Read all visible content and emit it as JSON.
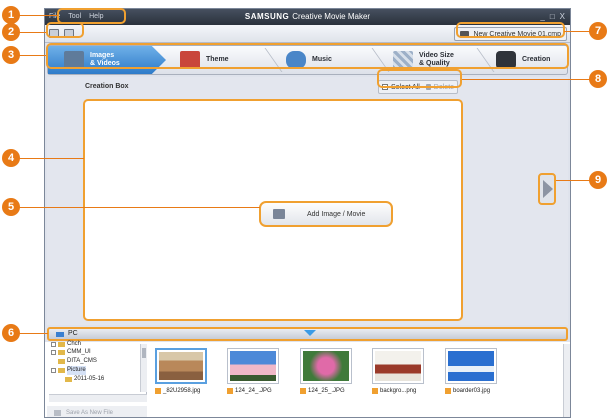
{
  "menu": [
    "File",
    "Tool",
    "Help"
  ],
  "app": {
    "brand": "SAMSUNG",
    "title": "Creative Movie Maker"
  },
  "window_controls": [
    "_",
    "□",
    "X"
  ],
  "project_file": "New Creative Movie 01.cmp",
  "steps": [
    {
      "line1": "Images",
      "line2": "& Videos",
      "active": true
    },
    {
      "line1": "Theme",
      "line2": ""
    },
    {
      "line1": "Music",
      "line2": ""
    },
    {
      "line1": "Video Size",
      "line2": "& Quality"
    },
    {
      "line1": "Creation",
      "line2": ""
    }
  ],
  "creation_box": {
    "title": "Creation Box",
    "select_all": "Select All",
    "delete": "Delete",
    "add_button": "Add Image / Movie"
  },
  "pc_bar": {
    "label": "PC"
  },
  "tree": [
    {
      "label": "Chch",
      "level": 1
    },
    {
      "label": "CMM_UI",
      "level": 1
    },
    {
      "label": "DITA_CMS",
      "level": 1
    },
    {
      "label": "Picture",
      "level": 1,
      "selected": true
    },
    {
      "label": "2011-05-16",
      "level": 2
    }
  ],
  "save_as": "Save As New File",
  "files": [
    "_82U2958.jpg",
    "124_24_.JPG",
    "124_25_.JPG",
    "backgro...png",
    "boarder03.jpg"
  ],
  "callouts": [
    "1",
    "2",
    "3",
    "4",
    "5",
    "6",
    "7",
    "8",
    "9"
  ],
  "colors": {
    "accent": "#f0a030",
    "callout": "#e87a16",
    "step_active": "#2e7bc9"
  }
}
